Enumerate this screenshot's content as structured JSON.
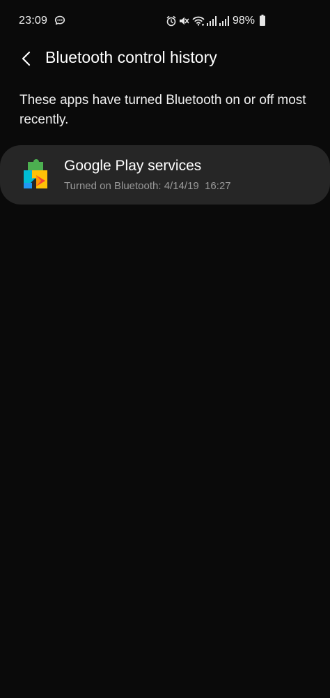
{
  "status_bar": {
    "time": "23:09",
    "battery_percent": "98%",
    "icons": [
      "chat-bubble-icon",
      "alarm-icon",
      "mute-icon",
      "wifi-icon",
      "signal-icon",
      "signal-icon",
      "battery-icon"
    ]
  },
  "header": {
    "title": "Bluetooth control history",
    "back_icon": "back-arrow-icon"
  },
  "description": "These apps have turned Bluetooth on or off most recently.",
  "apps": [
    {
      "name": "Google Play services",
      "detail": "Turned on Bluetooth: 4/14/19  16:27",
      "icon": "google-play-services-icon"
    }
  ],
  "colors": {
    "background": "#0a0a0a",
    "card": "#262626",
    "text_primary": "#ffffff",
    "text_secondary": "#9a9a9a"
  }
}
